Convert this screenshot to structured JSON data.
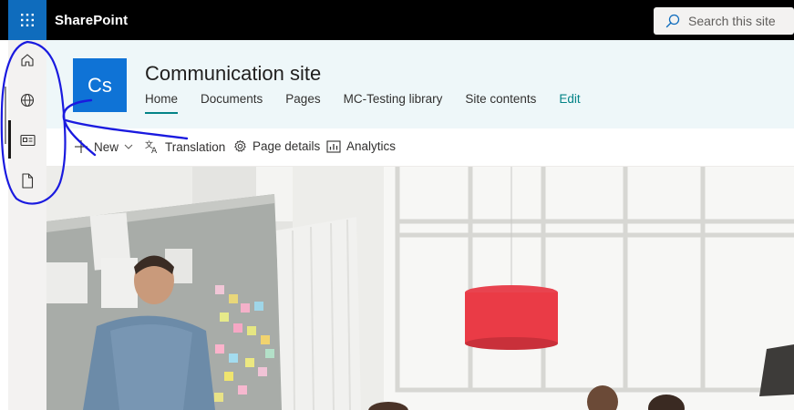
{
  "suite_bar": {
    "app_name": "SharePoint",
    "search_placeholder": "Search this site",
    "colors": {
      "bar": "#000000",
      "waffle": "#0f6cbd"
    }
  },
  "app_rail": {
    "items": [
      {
        "icon": "home-icon"
      },
      {
        "icon": "globe-icon"
      },
      {
        "icon": "news-icon"
      },
      {
        "icon": "document-icon"
      }
    ]
  },
  "site_header": {
    "logo_initials": "Cs",
    "title": "Communication site",
    "nav": [
      {
        "label": "Home",
        "active": true
      },
      {
        "label": "Documents"
      },
      {
        "label": "Pages"
      },
      {
        "label": "MC-Testing library"
      },
      {
        "label": "Site contents"
      },
      {
        "label": "Edit"
      }
    ],
    "colors": {
      "background": "#eef7f9",
      "logo": "#0f73d6",
      "accent": "#038387"
    }
  },
  "command_bar": {
    "new_label": "New",
    "translation_label": "Translation",
    "page_details_label": "Page details",
    "analytics_label": "Analytics"
  },
  "annotation": {
    "color": "#1a1adf"
  }
}
